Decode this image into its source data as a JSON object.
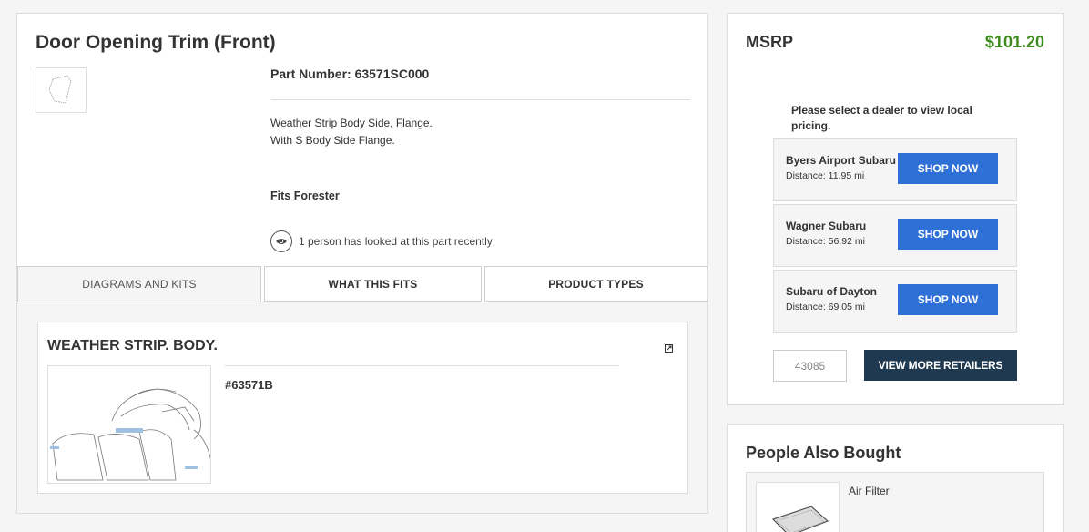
{
  "product": {
    "title": "Door Opening Trim (Front)",
    "part_number": "Part Number: 63571SC000",
    "description_line1": "Weather Strip Body Side, Flange.",
    "description_line2": "With S Body Side Flange.",
    "fits": "Fits Forester",
    "looked_text": "1 person has looked at this part recently"
  },
  "tabs": [
    {
      "label": "DIAGRAMS AND KITS",
      "active": true
    },
    {
      "label": "WHAT THIS FITS",
      "active": false
    },
    {
      "label": "PRODUCT TYPES",
      "active": false
    }
  ],
  "diagram": {
    "title": "WEATHER STRIP. BODY.",
    "code": "#63571B"
  },
  "msrp": {
    "label": "MSRP",
    "price": "$101.20",
    "select_note": "Please select a dealer to view local pricing."
  },
  "dealers": [
    {
      "name": "Byers Airport Subaru",
      "distance": "Distance: 11.95 mi",
      "button": "SHOP NOW"
    },
    {
      "name": "Wagner Subaru",
      "distance": "Distance: 56.92 mi",
      "button": "SHOP NOW"
    },
    {
      "name": "Subaru of Dayton",
      "distance": "Distance: 69.05 mi",
      "button": "SHOP NOW"
    }
  ],
  "retailers": {
    "zip_value": "43085",
    "view_more_label": "VIEW MORE RETAILERS"
  },
  "also_bought": {
    "title": "People Also Bought",
    "items": [
      {
        "name": "Air Filter"
      }
    ]
  },
  "colors": {
    "price_green": "#3d8b1d",
    "shop_blue": "#2f70d6",
    "view_more_navy": "#1f3a50"
  },
  "icons": {
    "eye": "eye-icon",
    "external_link": "external-link-icon"
  }
}
